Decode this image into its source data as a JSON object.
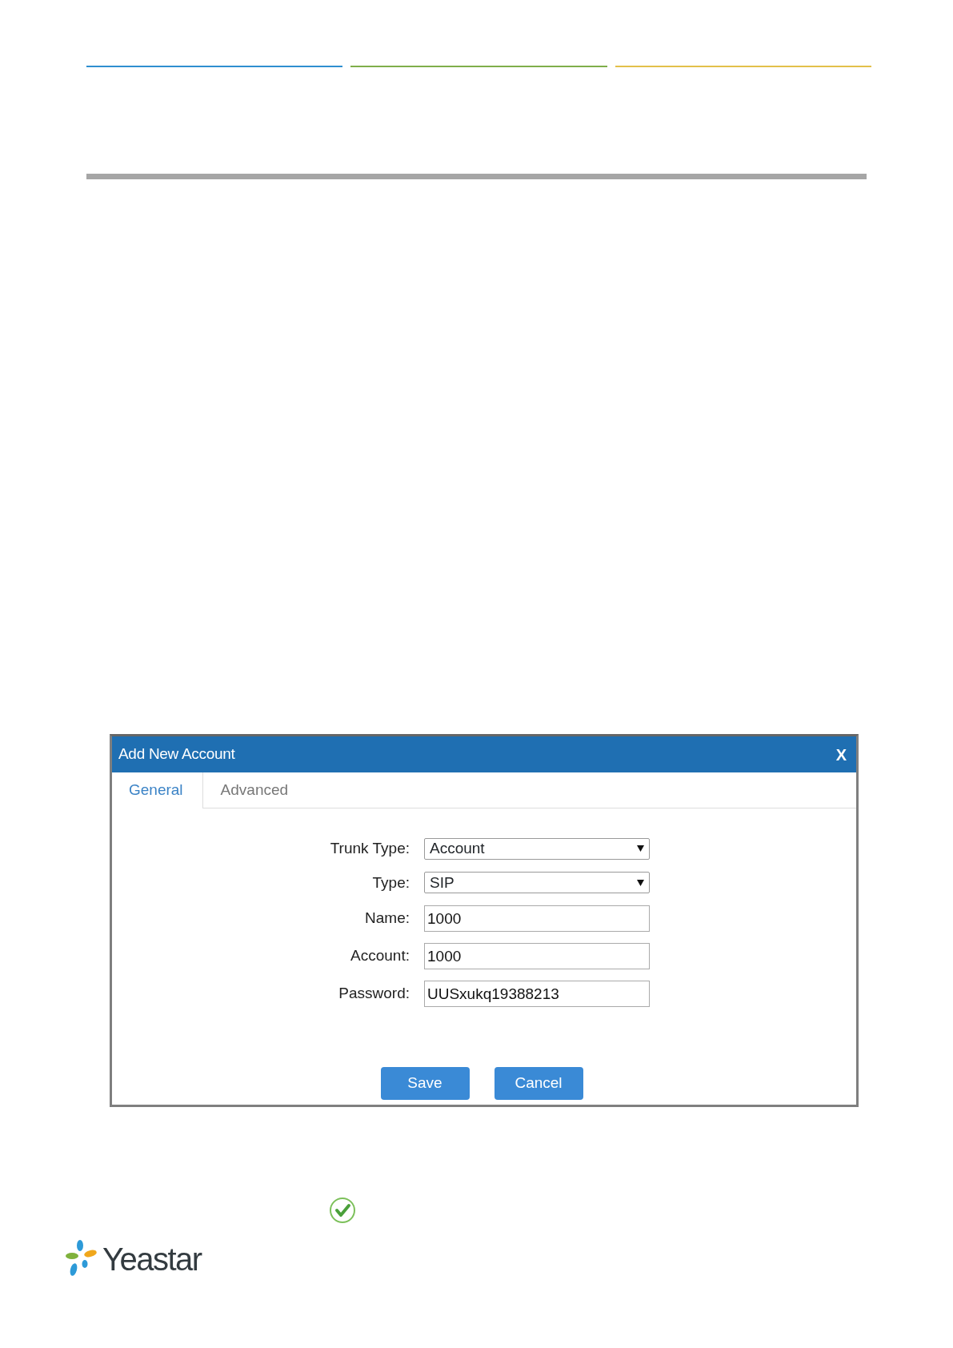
{
  "dialog": {
    "title": "Add New Account",
    "close": "X",
    "tabs": [
      {
        "label": "General",
        "selected": true
      },
      {
        "label": "Advanced",
        "selected": false
      }
    ],
    "fields": [
      {
        "kind": "select",
        "label": "Trunk Type:",
        "value": "Account"
      },
      {
        "kind": "select",
        "label": "Type:",
        "value": "SIP"
      },
      {
        "kind": "input",
        "label": "Name:",
        "value": "1000"
      },
      {
        "kind": "input",
        "label": "Account:",
        "value": "1000"
      },
      {
        "kind": "input",
        "label": "Password:",
        "value": "UUSxukq19388213"
      }
    ],
    "buttons": [
      "Save",
      "Cancel"
    ]
  },
  "footer": {
    "logo": "Yeastar"
  }
}
